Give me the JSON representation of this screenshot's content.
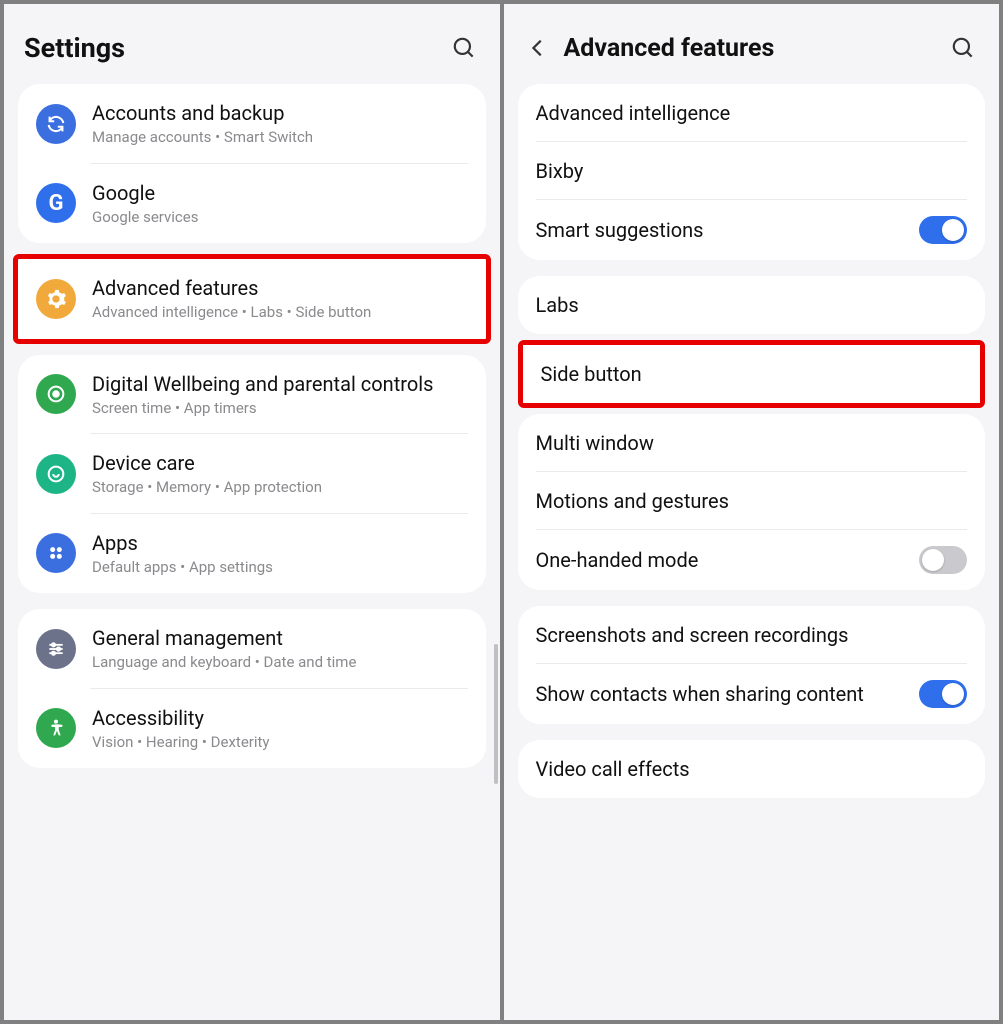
{
  "left": {
    "title": "Settings",
    "groups": [
      {
        "items": [
          {
            "icon": "sync-icon",
            "color": "#3b6fe0",
            "title": "Accounts and backup",
            "sub": "Manage accounts  •  Smart Switch"
          },
          {
            "icon": "google-icon",
            "color": "#2f6fec",
            "title": "Google",
            "sub": "Google services"
          }
        ]
      },
      {
        "highlight": true,
        "items": [
          {
            "icon": "gear-icon",
            "color": "#f2a93b",
            "title": "Advanced features",
            "sub": "Advanced intelligence  •  Labs  •  Side button"
          }
        ]
      },
      {
        "items": [
          {
            "icon": "wellbeing-icon",
            "color": "#2fa84f",
            "title": "Digital Wellbeing and parental controls",
            "sub": "Screen time  •  App timers"
          },
          {
            "icon": "device-care-icon",
            "color": "#1db586",
            "title": "Device care",
            "sub": "Storage  •  Memory  •  App protection"
          },
          {
            "icon": "apps-icon",
            "color": "#3b6fe0",
            "title": "Apps",
            "sub": "Default apps  •  App settings"
          }
        ]
      },
      {
        "items": [
          {
            "icon": "sliders-icon",
            "color": "#6b728a",
            "title": "General management",
            "sub": "Language and keyboard  •  Date and time"
          },
          {
            "icon": "accessibility-icon",
            "color": "#2fa84f",
            "title": "Accessibility",
            "sub": "Vision  •  Hearing  •  Dexterity"
          }
        ]
      }
    ]
  },
  "right": {
    "title": "Advanced features",
    "groups": [
      {
        "items": [
          {
            "title": "Advanced intelligence"
          },
          {
            "title": "Bixby"
          },
          {
            "title": "Smart suggestions",
            "toggle": "on"
          }
        ]
      },
      {
        "items": [
          {
            "title": "Labs"
          }
        ]
      },
      {
        "highlight": true,
        "items": [
          {
            "title": "Side button"
          }
        ]
      },
      {
        "items": [
          {
            "title": "Multi window"
          },
          {
            "title": "Motions and gestures"
          },
          {
            "title": "One-handed mode",
            "toggle": "off"
          }
        ]
      },
      {
        "items": [
          {
            "title": "Screenshots and screen recordings"
          },
          {
            "title": "Show contacts when sharing content",
            "toggle": "on"
          }
        ]
      },
      {
        "items": [
          {
            "title": "Video call effects"
          }
        ]
      }
    ]
  }
}
